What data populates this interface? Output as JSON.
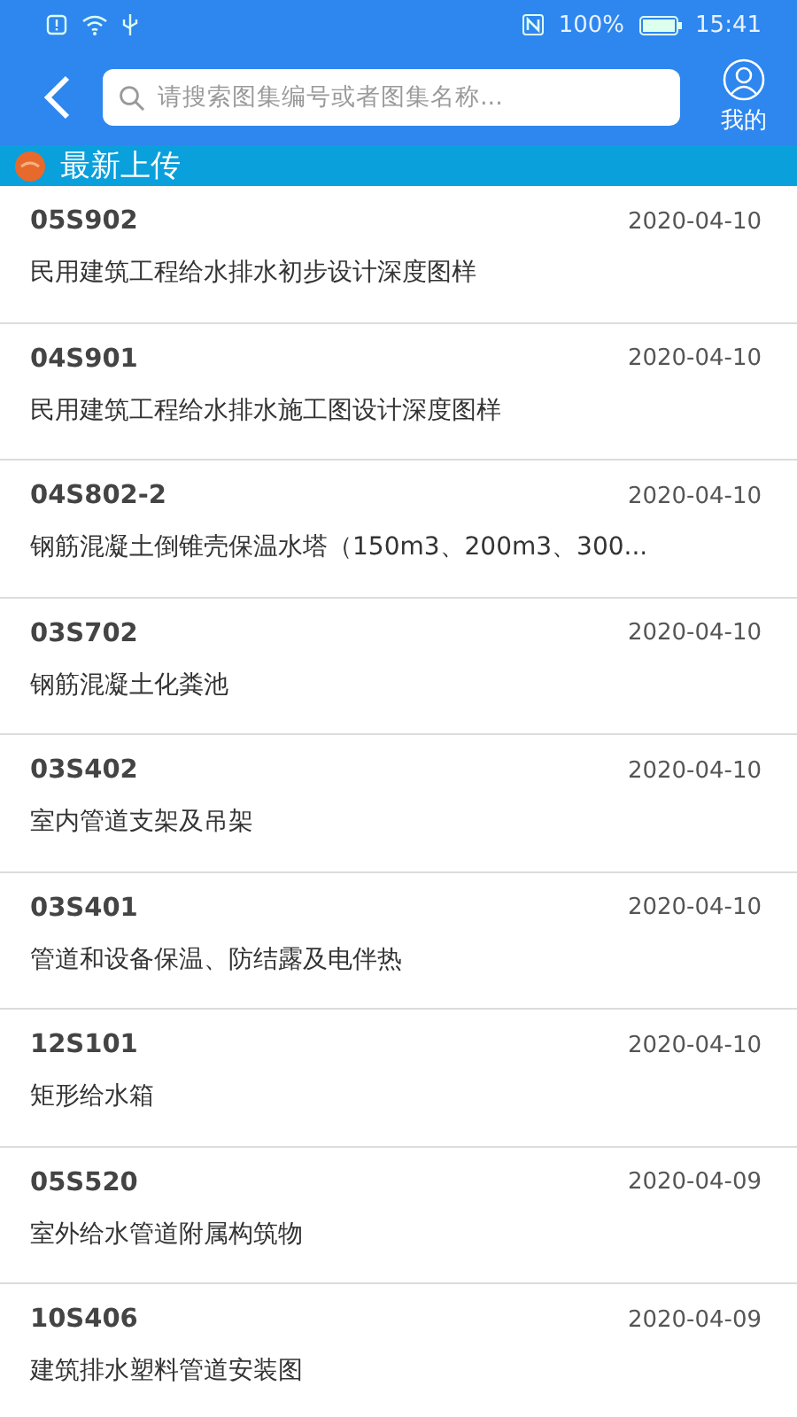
{
  "status_bar": {
    "battery": "100%",
    "time": "15:41"
  },
  "header": {
    "search": {
      "placeholder": "请搜索图集编号或者图集名称..."
    },
    "profile_label": "我的"
  },
  "section": {
    "title": "最新上传"
  },
  "items": [
    {
      "code": "05S902",
      "date": "2020-04-10",
      "title": "民用建筑工程给水排水初步设计深度图样"
    },
    {
      "code": "04S901",
      "date": "2020-04-10",
      "title": "民用建筑工程给水排水施工图设计深度图样"
    },
    {
      "code": "04S802-2",
      "date": "2020-04-10",
      "title": "钢筋混凝土倒锥壳保温水塔（150m3、200m3、300..."
    },
    {
      "code": "03S702",
      "date": "2020-04-10",
      "title": "钢筋混凝土化粪池"
    },
    {
      "code": "03S402",
      "date": "2020-04-10",
      "title": "室内管道支架及吊架"
    },
    {
      "code": "03S401",
      "date": "2020-04-10",
      "title": "管道和设备保温、防结露及电伴热"
    },
    {
      "code": "12S101",
      "date": "2020-04-10",
      "title": "矩形给水箱"
    },
    {
      "code": "05S520",
      "date": "2020-04-09",
      "title": "室外给水管道附属构筑物"
    },
    {
      "code": "10S406",
      "date": "2020-04-09",
      "title": "建筑排水塑料管道安装图"
    }
  ]
}
